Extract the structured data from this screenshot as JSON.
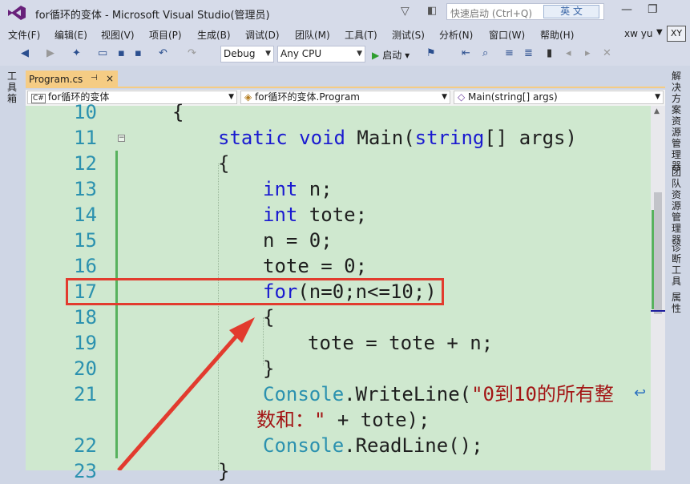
{
  "window": {
    "title": "for循环的变体 - Microsoft Visual Studio(管理员)",
    "quick_launch_placeholder": "快速启动 (Ctrl+Q)",
    "ime_indicator": "英 文",
    "minimize": "—",
    "restore": "❐"
  },
  "menu": {
    "items": [
      "文件(F)",
      "编辑(E)",
      "视图(V)",
      "项目(P)",
      "生成(B)",
      "调试(D)",
      "团队(M)",
      "工具(T)",
      "测试(S)",
      "分析(N)",
      "窗口(W)",
      "帮助(H)"
    ],
    "user_name": "xw yu",
    "avatar_initials": "XY"
  },
  "toolbar": {
    "configuration": "Debug",
    "platform": "Any CPU",
    "start_label": "启动"
  },
  "side_panels": {
    "left": [
      "工具箱"
    ],
    "right": [
      "解决方案资源管理器",
      "团队资源管理器",
      "诊断工具",
      "属性"
    ]
  },
  "document": {
    "tab_name": "Program.cs",
    "pin_glyph": "⊣",
    "close_glyph": "×",
    "nav_project": "for循环的变体",
    "nav_class": "for循环的变体.Program",
    "nav_member": "Main(string[] args)",
    "nav_project_icon_text": "C#"
  },
  "code": {
    "line_numbers": [
      "10",
      "11",
      "12",
      "13",
      "14",
      "15",
      "16",
      "17",
      "18",
      "19",
      "20",
      "21",
      "",
      "22",
      "23"
    ],
    "lines": {
      "l10": "{",
      "l11_kw1": "static",
      "l11_kw2": "void",
      "l11_rest1": " Main(",
      "l11_kw3": "string",
      "l11_rest2": "[] args)",
      "l12": "{",
      "l13_kw": "int",
      "l13_rest": " n;",
      "l14_kw": "int",
      "l14_rest": " tote;",
      "l15": "n = 0;",
      "l16": "tote = 0;",
      "l17_kw": "for",
      "l17_rest": "(n=0;n<=10;)",
      "l18": "{",
      "l19": "tote = tote + n;",
      "l20": "}",
      "l21_cls": "Console",
      "l21_rest": ".WriteLine(",
      "l21_str": "\"0到10的所有整",
      "l21b_str": "数和：\"",
      "l21b_rest": " + tote);",
      "l22_cls": "Console",
      "l22_rest": ".ReadLine();",
      "l23": "}"
    }
  },
  "colors": {
    "editor_background": "#cfe8cf",
    "keyword": "#1a1ad0",
    "type_name": "#2b91af",
    "string": "#a31515",
    "highlight_annotation": "#e23b2e",
    "tab_active": "#f5cc84"
  }
}
